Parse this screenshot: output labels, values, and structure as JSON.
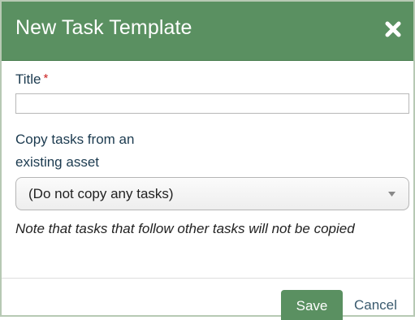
{
  "dialog": {
    "title": "New Task Template",
    "close_icon": "close-icon"
  },
  "title_field": {
    "label": "Title",
    "required_mark": "*",
    "value": "",
    "placeholder": ""
  },
  "copy_field": {
    "label_line1": "Copy tasks from an",
    "label_line2": "existing asset",
    "selected": "(Do not copy any tasks)",
    "icon": "chevron-down-icon"
  },
  "note": "Note that tasks that follow other tasks will not be copied",
  "footer": {
    "save_label": "Save",
    "cancel_label": "Cancel"
  },
  "colors": {
    "header_bg": "#5a9061",
    "save_bg": "#5a9061",
    "required": "#cc2222",
    "label_text": "#1b3a4f"
  }
}
